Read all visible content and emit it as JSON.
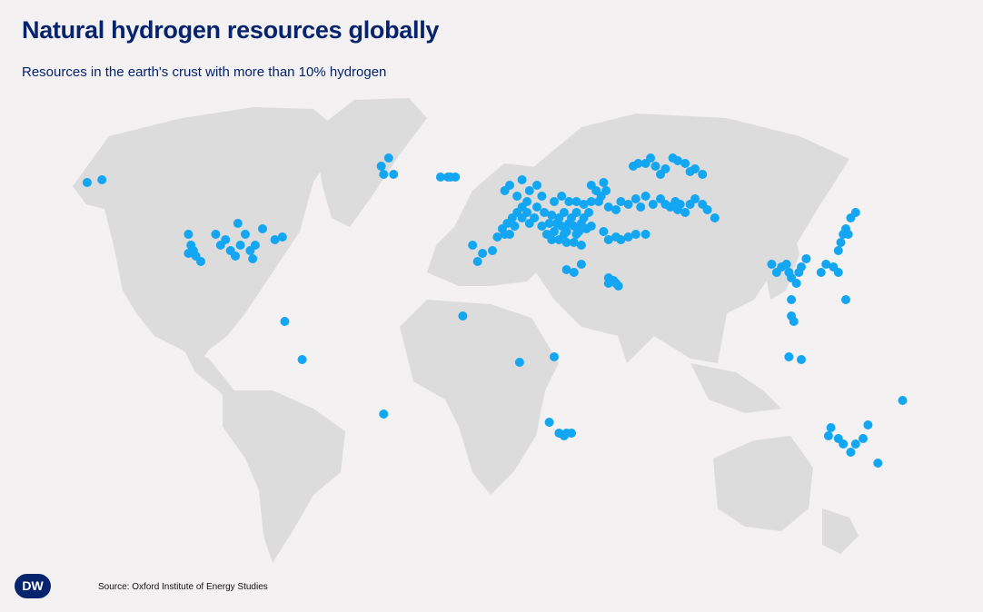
{
  "header": {
    "title": "Natural hydrogen resources globally",
    "subtitle": "Resources in the earth's crust with more than 10% hydrogen"
  },
  "footer": {
    "logo_text": "DW",
    "source": "Source: Oxford Institute of Energy Studies"
  },
  "colors": {
    "marker": "#12a6f3",
    "land": "#dcdcdc",
    "background": "#f3f1f2",
    "text": "#06246e"
  },
  "map_data": {
    "projection": "world map",
    "marker_style": "circle",
    "sites": [
      [
        -164,
        63
      ],
      [
        -158,
        64
      ],
      [
        -123,
        44
      ],
      [
        -122,
        40
      ],
      [
        -121,
        38
      ],
      [
        -120,
        36
      ],
      [
        -118,
        34
      ],
      [
        -123,
        37
      ],
      [
        -112,
        44
      ],
      [
        -110,
        40
      ],
      [
        -108,
        42
      ],
      [
        -106,
        38
      ],
      [
        -104,
        36
      ],
      [
        -102,
        40
      ],
      [
        -100,
        44
      ],
      [
        -98,
        38
      ],
      [
        -97,
        35
      ],
      [
        -96,
        40
      ],
      [
        -93,
        46
      ],
      [
        -88,
        42
      ],
      [
        -85,
        43
      ],
      [
        -103,
        48
      ],
      [
        -84,
        12
      ],
      [
        -77,
        -2
      ],
      [
        -44,
        -22
      ],
      [
        -42,
        72
      ],
      [
        -45,
        69
      ],
      [
        -44,
        66
      ],
      [
        -40,
        66
      ],
      [
        -21,
        65
      ],
      [
        -18,
        65
      ],
      [
        -17,
        65
      ],
      [
        -15,
        65
      ],
      [
        -8,
        40
      ],
      [
        -4,
        37
      ],
      [
        -6,
        34
      ],
      [
        -12,
        14
      ],
      [
        0,
        38
      ],
      [
        2,
        43
      ],
      [
        5,
        44
      ],
      [
        7,
        44
      ],
      [
        4,
        46
      ],
      [
        6,
        48
      ],
      [
        8,
        50
      ],
      [
        10,
        52
      ],
      [
        12,
        54
      ],
      [
        9,
        47
      ],
      [
        15,
        48
      ],
      [
        17,
        50
      ],
      [
        12,
        50
      ],
      [
        14,
        52
      ],
      [
        5,
        60
      ],
      [
        7,
        62
      ],
      [
        10,
        58
      ],
      [
        12,
        64
      ],
      [
        15,
        60
      ],
      [
        18,
        62
      ],
      [
        20,
        58
      ],
      [
        14,
        56
      ],
      [
        18,
        54
      ],
      [
        20,
        47
      ],
      [
        21,
        52
      ],
      [
        23,
        48
      ],
      [
        24,
        51
      ],
      [
        25,
        45
      ],
      [
        26,
        48
      ],
      [
        27,
        50
      ],
      [
        28,
        47
      ],
      [
        29,
        52
      ],
      [
        30,
        45
      ],
      [
        31,
        48
      ],
      [
        32,
        50
      ],
      [
        33,
        47
      ],
      [
        34,
        52
      ],
      [
        35,
        45
      ],
      [
        36,
        48
      ],
      [
        37,
        50
      ],
      [
        38,
        46
      ],
      [
        39,
        52
      ],
      [
        40,
        47
      ],
      [
        27,
        42
      ],
      [
        30,
        41
      ],
      [
        33,
        41
      ],
      [
        36,
        40
      ],
      [
        29,
        44
      ],
      [
        34,
        44
      ],
      [
        22,
        44
      ],
      [
        24,
        42
      ],
      [
        31,
        56
      ],
      [
        34,
        56
      ],
      [
        37,
        55
      ],
      [
        40,
        56
      ],
      [
        43,
        56
      ],
      [
        25,
        56
      ],
      [
        28,
        58
      ],
      [
        40,
        62
      ],
      [
        42,
        60
      ],
      [
        44,
        58
      ],
      [
        46,
        60
      ],
      [
        45,
        63
      ],
      [
        47,
        54
      ],
      [
        50,
        53
      ],
      [
        52,
        56
      ],
      [
        55,
        55
      ],
      [
        58,
        57
      ],
      [
        60,
        54
      ],
      [
        62,
        58
      ],
      [
        65,
        55
      ],
      [
        68,
        57
      ],
      [
        70,
        55
      ],
      [
        72,
        54
      ],
      [
        74,
        56
      ],
      [
        75,
        53
      ],
      [
        76,
        55
      ],
      [
        78,
        52
      ],
      [
        80,
        55
      ],
      [
        82,
        57
      ],
      [
        85,
        55
      ],
      [
        87,
        53
      ],
      [
        90,
        50
      ],
      [
        45,
        45
      ],
      [
        47,
        42
      ],
      [
        50,
        43
      ],
      [
        52,
        42
      ],
      [
        55,
        43
      ],
      [
        58,
        44
      ],
      [
        62,
        44
      ],
      [
        57,
        69
      ],
      [
        59,
        70
      ],
      [
        62,
        70
      ],
      [
        64,
        72
      ],
      [
        66,
        69
      ],
      [
        68,
        66
      ],
      [
        70,
        68
      ],
      [
        73,
        72
      ],
      [
        75,
        71
      ],
      [
        78,
        70
      ],
      [
        80,
        67
      ],
      [
        82,
        68
      ],
      [
        85,
        66
      ],
      [
        30,
        31
      ],
      [
        33,
        30
      ],
      [
        36,
        33
      ],
      [
        47,
        28
      ],
      [
        49,
        27
      ],
      [
        50,
        26
      ],
      [
        51,
        25
      ],
      [
        47,
        26
      ],
      [
        25,
        -1
      ],
      [
        11,
        -3
      ],
      [
        23,
        -25
      ],
      [
        27,
        -29
      ],
      [
        29,
        -30
      ],
      [
        30,
        -29
      ],
      [
        32,
        -29
      ],
      [
        113,
        33
      ],
      [
        115,
        30
      ],
      [
        117,
        32
      ],
      [
        119,
        33
      ],
      [
        120,
        30
      ],
      [
        121,
        28
      ],
      [
        123,
        26
      ],
      [
        124,
        30
      ],
      [
        125,
        32
      ],
      [
        127,
        35
      ],
      [
        121,
        20
      ],
      [
        121,
        14
      ],
      [
        122,
        12
      ],
      [
        125,
        -2
      ],
      [
        120,
        -1
      ],
      [
        133,
        30
      ],
      [
        135,
        33
      ],
      [
        138,
        32
      ],
      [
        140,
        30
      ],
      [
        143,
        20
      ],
      [
        140,
        38
      ],
      [
        141,
        41
      ],
      [
        142,
        44
      ],
      [
        143,
        46
      ],
      [
        144,
        44
      ],
      [
        145,
        50
      ],
      [
        147,
        52
      ],
      [
        136,
        -30
      ],
      [
        137,
        -27
      ],
      [
        140,
        -31
      ],
      [
        142,
        -33
      ],
      [
        145,
        -36
      ],
      [
        147,
        -33
      ],
      [
        150,
        -31
      ],
      [
        152,
        -26
      ],
      [
        156,
        -40
      ],
      [
        166,
        -17
      ]
    ]
  }
}
